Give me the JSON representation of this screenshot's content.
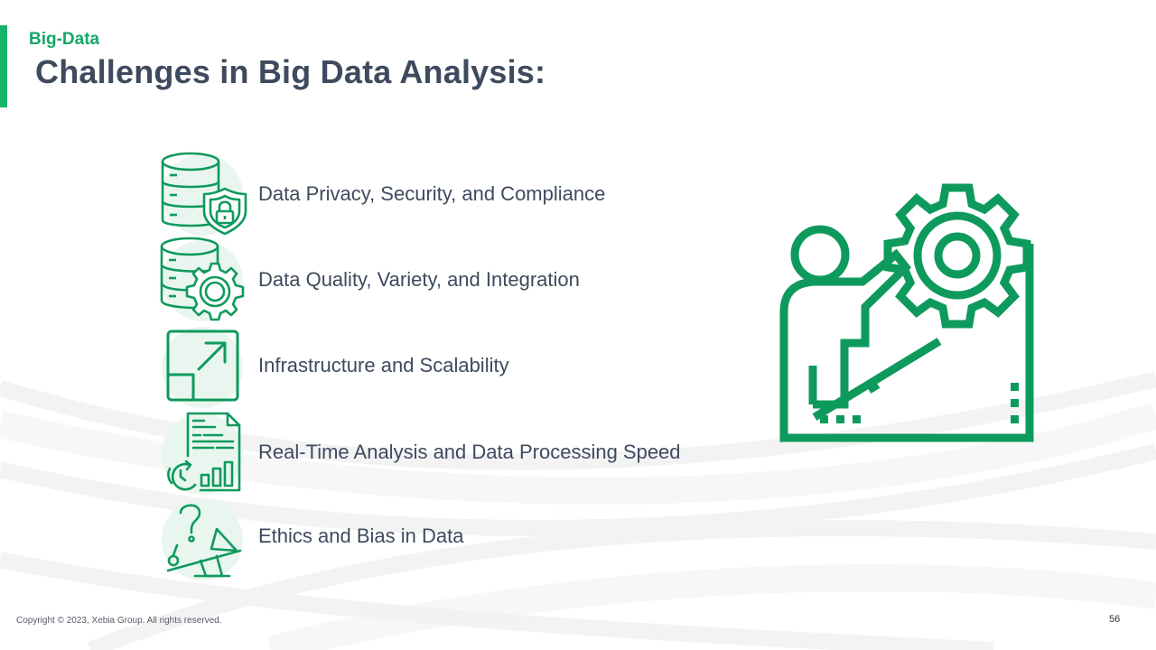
{
  "header": {
    "section_label": "Big-Data",
    "title": "Challenges in Big Data Analysis:"
  },
  "challenges": [
    {
      "label": "Data Privacy, Security, and Compliance",
      "icon": "database-shield-icon"
    },
    {
      "label": "Data Quality, Variety, and Integration",
      "icon": "database-gear-icon"
    },
    {
      "label": "Infrastructure and Scalability",
      "icon": "scale-arrow-icon"
    },
    {
      "label": "Real-Time Analysis and Data Processing Speed",
      "icon": "report-chart-refresh-icon"
    },
    {
      "label": "Ethics and Bias in Data",
      "icon": "question-seesaw-icon"
    }
  ],
  "illustration": {
    "icon": "person-pushing-gear-icon"
  },
  "footer": {
    "copyright": "Copyright © 2023, Xebia Group. All rights reserved.",
    "page_number": "56"
  },
  "colors": {
    "accent": "#19b36b",
    "icon_green": "#0e9a5c",
    "text": "#3e4a5e"
  }
}
